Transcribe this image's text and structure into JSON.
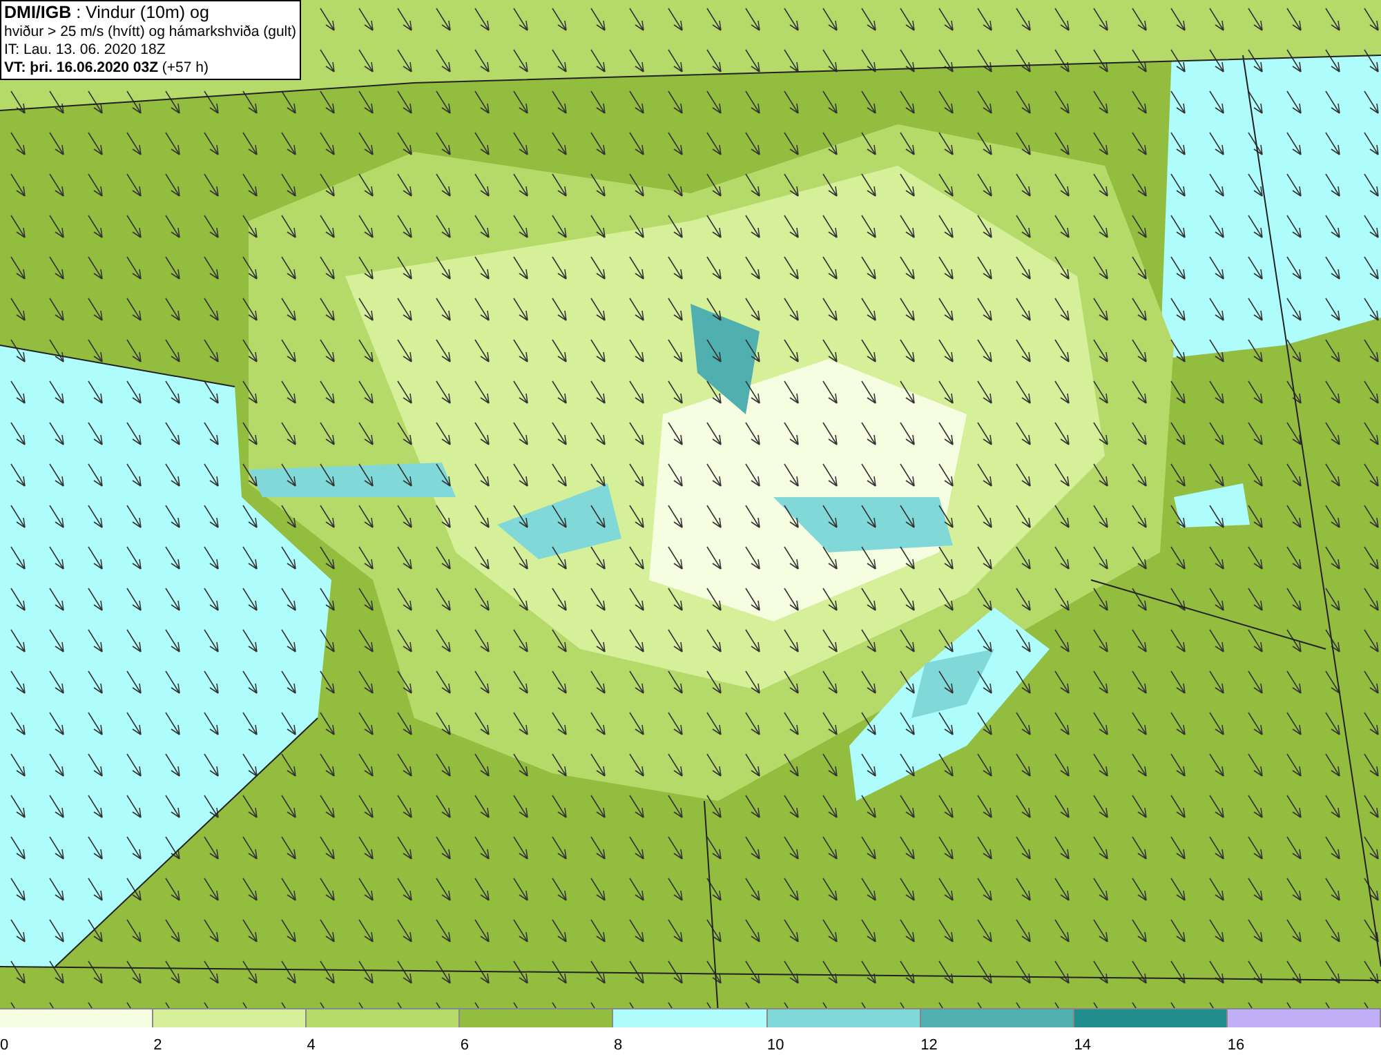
{
  "title_box": {
    "lines": [
      "**DMI/IGB** : Vindur (10m) og",
      "hviður > 25 m/s (hvítt) og hámarkshviða (gult)",
      "IT: Lau. 13. 06. 2020 18Z",
      "**VT: þri. 16.06.2020 03Z** (+57 h)"
    ]
  },
  "legend": [
    {
      "label": "0",
      "color": "#f7fde0"
    },
    {
      "label": "2",
      "color": "#d6f09a"
    },
    {
      "label": "4",
      "color": "#b5da6a"
    },
    {
      "label": "6",
      "color": "#93bd3e"
    },
    {
      "label": "8",
      "color": "#aefcfc"
    },
    {
      "label": "10",
      "color": "#80d8d8"
    },
    {
      "label": "12",
      "color": "#50b0b0"
    },
    {
      "label": "14",
      "color": "#208c8c"
    },
    {
      "label": "16",
      "color": "#c0aef8"
    }
  ]
}
